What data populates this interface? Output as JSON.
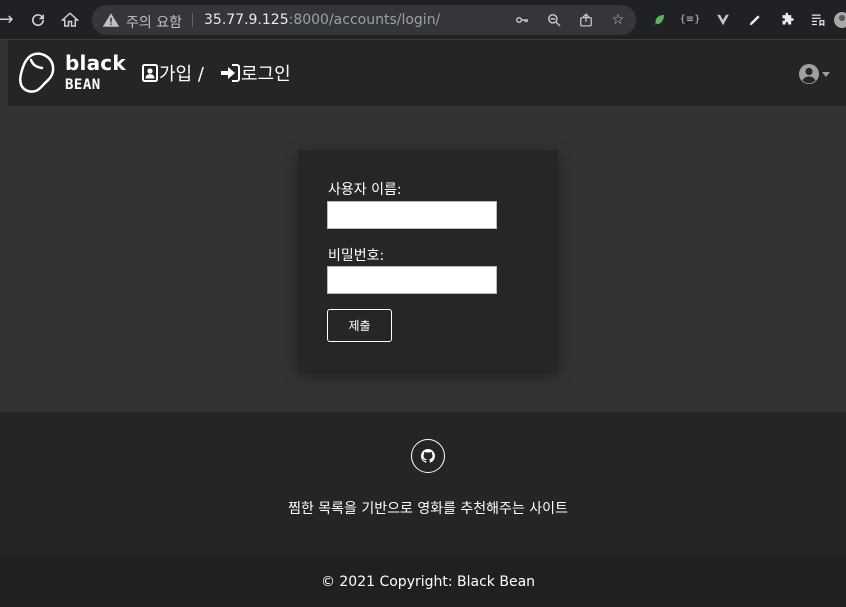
{
  "browser": {
    "security_warning": "주의 요함",
    "url_host": "35.77.9.125",
    "url_rest": ":8000/accounts/login/"
  },
  "site": {
    "logo_top": "black",
    "logo_bottom": "BEAN",
    "nav": {
      "signup_label": "가입 /",
      "login_label": "로그인"
    }
  },
  "login_form": {
    "username_label": "사용자 이름:",
    "username_value": "",
    "password_label": "비밀번호:",
    "password_value": "",
    "submit_label": "제출"
  },
  "footer": {
    "tagline": "찜한 목록을 기반으로 영화를 추천해주는 사이트",
    "copyright": "© 2021 Copyright: Black Bean"
  }
}
